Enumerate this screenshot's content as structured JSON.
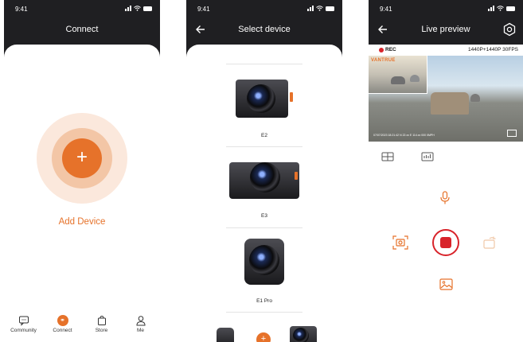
{
  "status": {
    "time": "9:41"
  },
  "screens": {
    "connect": {
      "title": "Connect",
      "add_label": "Add Device",
      "add_symbol": "+",
      "tabs": [
        {
          "label": "Community",
          "icon": "chat-icon"
        },
        {
          "label": "Connect",
          "icon": "link-icon"
        },
        {
          "label": "Store",
          "icon": "bag-icon"
        },
        {
          "label": "Me",
          "icon": "person-icon"
        }
      ]
    },
    "select_device": {
      "title": "Select device",
      "devices": [
        {
          "name": "E2"
        },
        {
          "name": "E3"
        },
        {
          "name": "E1 Pro"
        }
      ]
    },
    "live_preview": {
      "title": "Live preview",
      "rec_label": "REC",
      "resolution": "1440P+1440P 30FPS",
      "brand": "VANTRUE",
      "stamp": "07/07/2023 18:21:42 N 22.xx E 114.xx 000 0MPH"
    }
  },
  "colors": {
    "accent": "#e6722a",
    "record": "#d8232a",
    "header": "#1f1f22"
  }
}
